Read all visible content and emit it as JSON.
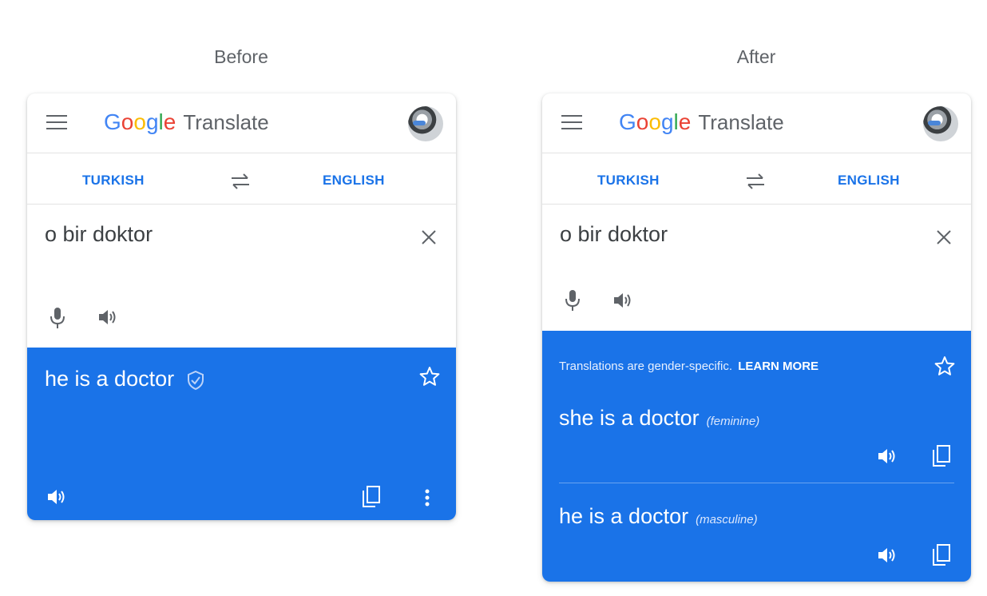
{
  "panels": {
    "before_title": "Before",
    "after_title": "After"
  },
  "app": {
    "brand_letters": [
      "G",
      "o",
      "o",
      "g",
      "l",
      "e"
    ],
    "product": "Translate",
    "source_language": "TURKISH",
    "target_language": "ENGLISH",
    "source_text": "o bir doktor"
  },
  "before": {
    "translation": "he is a doctor"
  },
  "after": {
    "notice": "Translations are gender-specific.",
    "learn_more": "LEARN MORE",
    "feminine_translation": "she is a doctor",
    "feminine_tag": "(feminine)",
    "masculine_translation": "he is a doctor",
    "masculine_tag": "(masculine)"
  },
  "icons": {
    "menu": "menu-icon",
    "swap": "swap-icon",
    "clear": "close-icon",
    "mic": "mic-icon",
    "speaker": "speaker-icon",
    "star": "star-icon",
    "copy": "copy-icon",
    "more": "more-vert-icon",
    "verified": "shield-check-icon"
  },
  "colors": {
    "accent": "#1a73e8",
    "google_blue": "#4285f4",
    "google_red": "#ea4335",
    "google_yellow": "#fbbc05",
    "google_green": "#34a853"
  }
}
